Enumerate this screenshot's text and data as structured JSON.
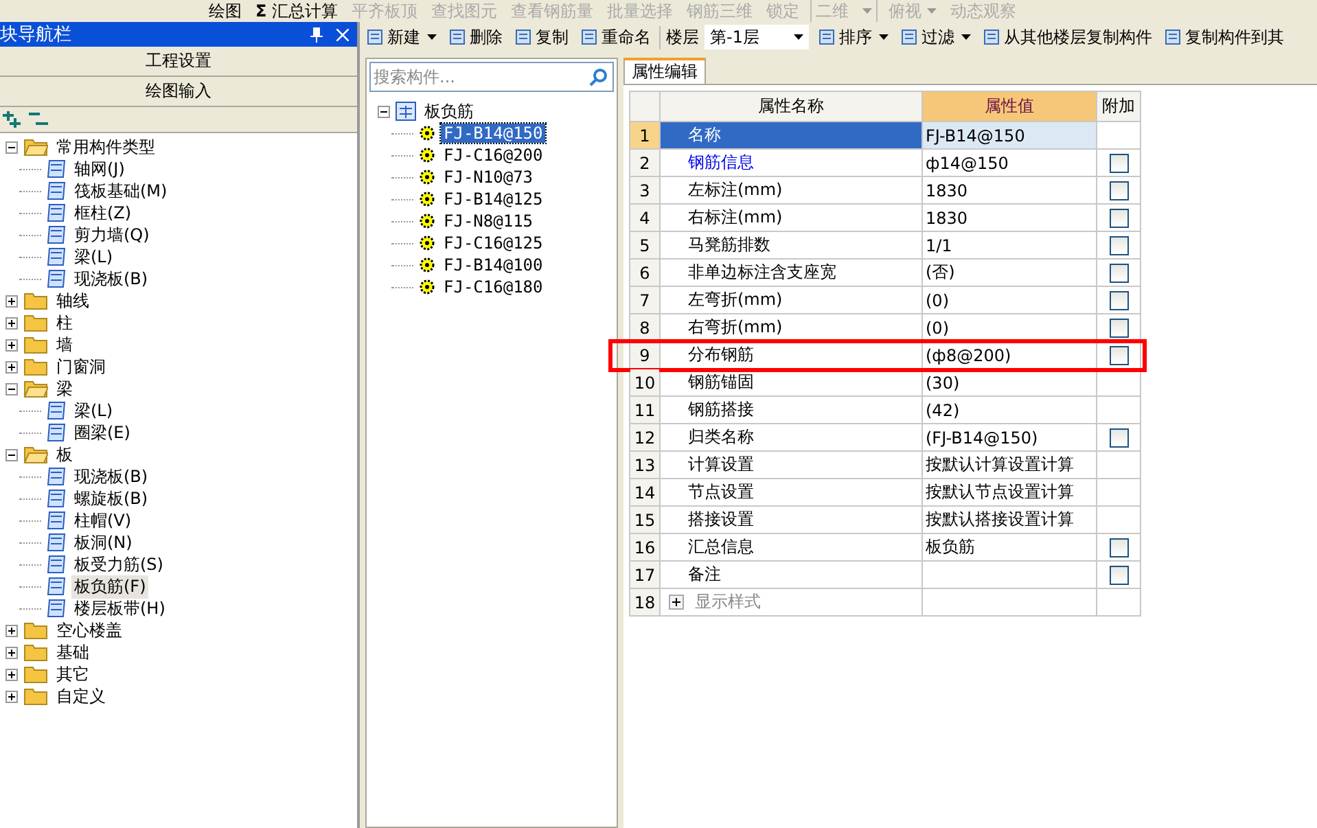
{
  "toolbar": [
    {
      "label": "绘图",
      "kind": "button",
      "disabled": false
    },
    {
      "label": "汇总计算",
      "glyph": "Σ",
      "kind": "button",
      "disabled": false
    },
    {
      "label": "平齐板顶",
      "kind": "button",
      "disabled": true
    },
    {
      "label": "查找图元",
      "kind": "button",
      "disabled": true
    },
    {
      "label": "查看钢筋量",
      "kind": "button",
      "disabled": true
    },
    {
      "label": "批量选择",
      "kind": "button",
      "disabled": true
    },
    {
      "label": "钢筋三维",
      "kind": "button",
      "disabled": true
    },
    {
      "label": "锁定",
      "kind": "button",
      "disabled": true
    },
    {
      "label": "二维",
      "kind": "select",
      "disabled": true
    },
    {
      "label": "俯视",
      "kind": "dropdown",
      "disabled": true
    },
    {
      "label": "动态观察",
      "kind": "button",
      "disabled": true
    }
  ],
  "nav": {
    "title": "块导航栏",
    "sections": [
      "工程设置",
      "绘图输入"
    ],
    "tree": [
      {
        "label": "常用构件类型",
        "expanded": true,
        "children": [
          {
            "label": "轴网(J)",
            "selected": false
          },
          {
            "label": "筏板基础(M)",
            "selected": false
          },
          {
            "label": "框柱(Z)",
            "selected": false
          },
          {
            "label": "剪力墙(Q)",
            "selected": false
          },
          {
            "label": "梁(L)",
            "selected": false
          },
          {
            "label": "现浇板(B)",
            "selected": false
          }
        ]
      },
      {
        "label": "轴线",
        "expanded": false
      },
      {
        "label": "柱",
        "expanded": false
      },
      {
        "label": "墙",
        "expanded": false
      },
      {
        "label": "门窗洞",
        "expanded": false
      },
      {
        "label": "梁",
        "expanded": true,
        "children": [
          {
            "label": "梁(L)",
            "selected": false
          },
          {
            "label": "圈梁(E)",
            "selected": false
          }
        ]
      },
      {
        "label": "板",
        "expanded": true,
        "children": [
          {
            "label": "现浇板(B)",
            "selected": false
          },
          {
            "label": "螺旋板(B)",
            "selected": false
          },
          {
            "label": "柱帽(V)",
            "selected": false
          },
          {
            "label": "板洞(N)",
            "selected": false
          },
          {
            "label": "板受力筋(S)",
            "selected": false
          },
          {
            "label": "板负筋(F)",
            "selected": true
          },
          {
            "label": "楼层板带(H)",
            "selected": false
          }
        ]
      },
      {
        "label": "空心楼盖",
        "expanded": false
      },
      {
        "label": "基础",
        "expanded": false
      },
      {
        "label": "其它",
        "expanded": false
      },
      {
        "label": "自定义",
        "expanded": false
      }
    ]
  },
  "component_toolbar": [
    {
      "label": "新建",
      "kind": "button",
      "dropdown": true
    },
    {
      "label": "删除",
      "kind": "button",
      "dropdown": false
    },
    {
      "label": "复制",
      "kind": "button",
      "dropdown": false
    },
    {
      "label": "重命名",
      "kind": "button",
      "dropdown": false
    },
    {
      "label": "楼层",
      "kind": "label"
    },
    {
      "label": "第-1层",
      "kind": "select",
      "dropdown": true
    },
    {
      "label": "排序",
      "kind": "button",
      "dropdown": true
    },
    {
      "label": "过滤",
      "kind": "button",
      "dropdown": true
    },
    {
      "label": "从其他楼层复制构件",
      "kind": "button",
      "dropdown": false
    },
    {
      "label": "复制构件到其",
      "kind": "button",
      "dropdown": false
    }
  ],
  "search": {
    "placeholder": "搜索构件..."
  },
  "component_tree": {
    "label": "板负筋",
    "expanded": true,
    "children": [
      {
        "label": "FJ-B14@150",
        "selected": true
      },
      {
        "label": "FJ-C16@200",
        "selected": false
      },
      {
        "label": "FJ-N10@73",
        "selected": false
      },
      {
        "label": "FJ-B14@125",
        "selected": false
      },
      {
        "label": "FJ-N8@115",
        "selected": false
      },
      {
        "label": "FJ-C16@125",
        "selected": false
      },
      {
        "label": "FJ-B14@100",
        "selected": false
      },
      {
        "label": "FJ-C16@180",
        "selected": false
      }
    ]
  },
  "tabs": [
    {
      "label": "属性编辑",
      "selected": true
    }
  ],
  "grid": {
    "columns": [
      "属性名称",
      "属性值",
      "附加"
    ],
    "rows": [
      {
        "num": "1",
        "name": "名称",
        "value": "FJ-B14@150",
        "kind": "plain",
        "selected": true,
        "framed": false
      },
      {
        "num": "2",
        "name": "钢筋信息",
        "value": "ф14@150",
        "kind": "link",
        "selected": false,
        "framed": false,
        "checked": false
      },
      {
        "num": "3",
        "name": "左标注(mm)",
        "value": "1830",
        "kind": "plain",
        "selected": false,
        "framed": false,
        "checked": false
      },
      {
        "num": "4",
        "name": "右标注(mm)",
        "value": "1830",
        "kind": "plain",
        "selected": false,
        "framed": false,
        "checked": false
      },
      {
        "num": "5",
        "name": "马凳筋排数",
        "value": "1/1",
        "kind": "plain",
        "selected": false,
        "framed": false,
        "checked": false
      },
      {
        "num": "6",
        "name": "非单边标注含支座宽",
        "value": "(否)",
        "kind": "plain",
        "selected": false,
        "framed": false,
        "checked": false
      },
      {
        "num": "7",
        "name": "左弯折(mm)",
        "value": "(0)",
        "kind": "plain",
        "selected": false,
        "framed": false,
        "checked": false
      },
      {
        "num": "8",
        "name": "右弯折(mm)",
        "value": "(0)",
        "kind": "plain",
        "selected": false,
        "framed": false,
        "checked": false
      },
      {
        "num": "9",
        "name": "分布钢筋",
        "value": "(ф8@200)",
        "kind": "plain",
        "selected": false,
        "framed": true,
        "checked": false
      },
      {
        "num": "10",
        "name": "钢筋锚固",
        "value": "(30)",
        "kind": "plain",
        "selected": false,
        "framed": false
      },
      {
        "num": "11",
        "name": "钢筋搭接",
        "value": "(42)",
        "kind": "plain",
        "selected": false,
        "framed": false
      },
      {
        "num": "12",
        "name": "归类名称",
        "value": "(FJ-B14@150)",
        "kind": "plain",
        "selected": false,
        "framed": false,
        "checked": false
      },
      {
        "num": "13",
        "name": "计算设置",
        "value": "按默认计算设置计算",
        "kind": "plain",
        "selected": false,
        "framed": false
      },
      {
        "num": "14",
        "name": "节点设置",
        "value": "按默认节点设置计算",
        "kind": "plain",
        "selected": false,
        "framed": false
      },
      {
        "num": "15",
        "name": "搭接设置",
        "value": "按默认搭接设置计算",
        "kind": "plain",
        "selected": false,
        "framed": false
      },
      {
        "num": "16",
        "name": "汇总信息",
        "value": "板负筋",
        "kind": "plain",
        "selected": false,
        "framed": false,
        "checked": false
      },
      {
        "num": "17",
        "name": "备注",
        "kind": "plain",
        "selected": false,
        "framed": false,
        "checked": false
      },
      {
        "num": "18",
        "name": "显示样式",
        "kind": "group",
        "expanded": false,
        "selected": false,
        "framed": false
      }
    ]
  }
}
